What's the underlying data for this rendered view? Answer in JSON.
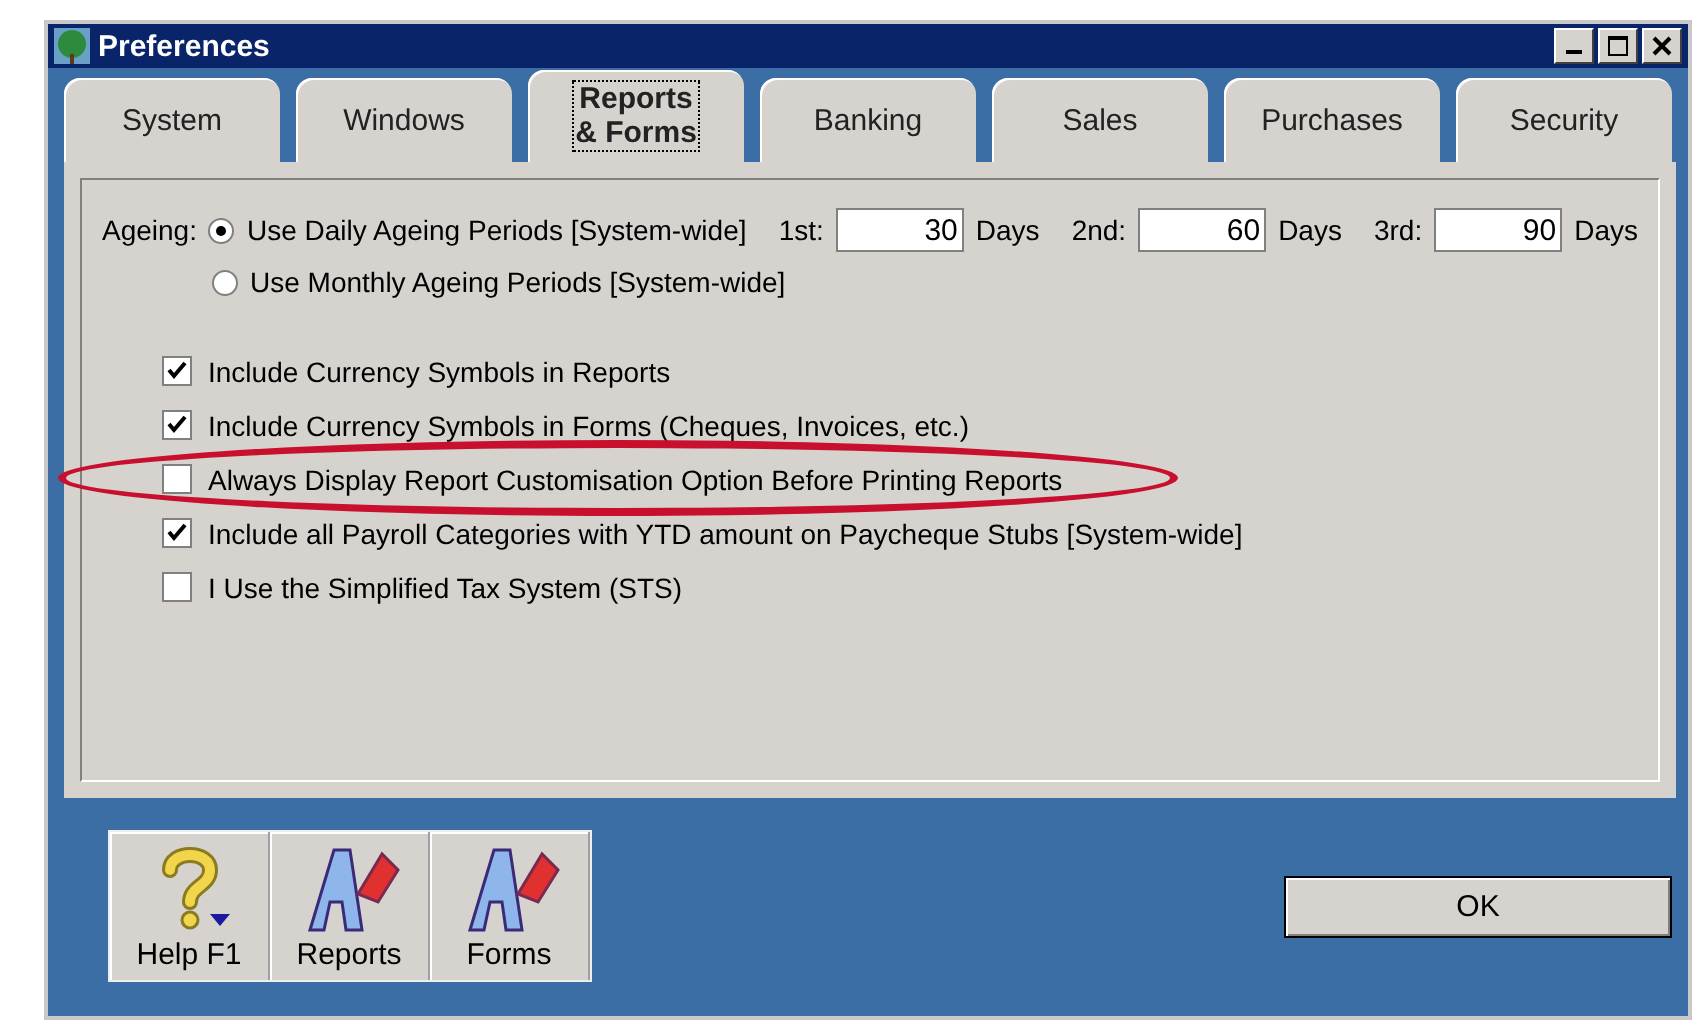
{
  "window": {
    "title": "Preferences"
  },
  "tabs": [
    {
      "label": "System",
      "selected": false
    },
    {
      "label": "Windows",
      "selected": false
    },
    {
      "label": "Reports & Forms",
      "selected": true
    },
    {
      "label": "Banking",
      "selected": false
    },
    {
      "label": "Sales",
      "selected": false
    },
    {
      "label": "Purchases",
      "selected": false
    },
    {
      "label": "Security",
      "selected": false
    }
  ],
  "ageing": {
    "label": "Ageing:",
    "options": [
      {
        "label": "Use Daily Ageing Periods [System-wide]",
        "selected": true
      },
      {
        "label": "Use Monthly Ageing Periods [System-wide]",
        "selected": false
      }
    ],
    "periods": [
      {
        "label": "1st:",
        "value": "30",
        "unit": "Days"
      },
      {
        "label": "2nd:",
        "value": "60",
        "unit": "Days"
      },
      {
        "label": "3rd:",
        "value": "90",
        "unit": "Days"
      }
    ]
  },
  "options": [
    {
      "label": "Include Currency Symbols in Reports",
      "checked": true,
      "highlighted": false
    },
    {
      "label": "Include Currency Symbols in Forms (Cheques, Invoices, etc.)",
      "checked": true,
      "highlighted": false
    },
    {
      "label": "Always Display Report Customisation Option Before Printing Reports",
      "checked": false,
      "highlighted": true
    },
    {
      "label": "Include all Payroll Categories with YTD amount on Paycheque Stubs [System-wide]",
      "checked": true,
      "highlighted": false
    },
    {
      "label": "I Use the Simplified Tax System (STS)",
      "checked": false,
      "highlighted": false
    }
  ],
  "toolbar": [
    {
      "label": "Help F1",
      "kind": "help"
    },
    {
      "label": "Reports",
      "kind": "reports"
    },
    {
      "label": "Forms",
      "kind": "forms"
    }
  ],
  "ok_button": "OK"
}
